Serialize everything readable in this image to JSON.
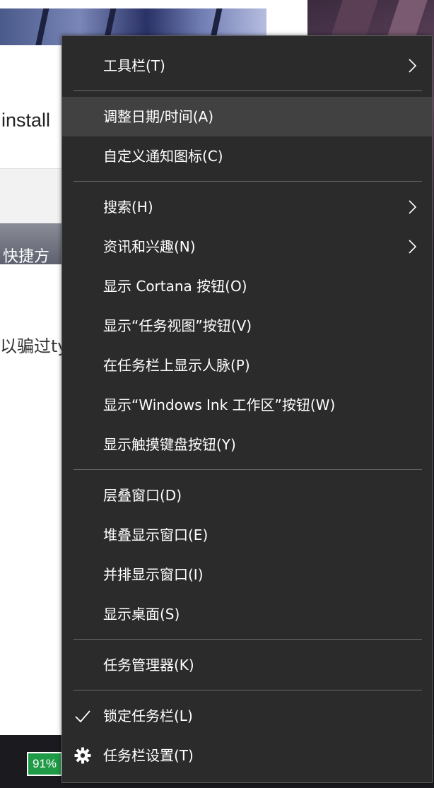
{
  "background": {
    "install_text": "install",
    "strip_text": "快捷方",
    "partial_text": "以骗过ty",
    "battery_level": "91%"
  },
  "context_menu": {
    "items": [
      {
        "label": "工具栏(T)",
        "submenu": true
      },
      {
        "label": "调整日期/时间(A)",
        "hover": true
      },
      {
        "label": "自定义通知图标(C)"
      },
      {
        "label": "搜索(H)",
        "submenu": true
      },
      {
        "label": "资讯和兴趣(N)",
        "submenu": true
      },
      {
        "label": "显示 Cortana 按钮(O)"
      },
      {
        "label": "显示“任务视图”按钮(V)"
      },
      {
        "label": "在任务栏上显示人脉(P)"
      },
      {
        "label": "显示“Windows Ink 工作区”按钮(W)"
      },
      {
        "label": "显示触摸键盘按钮(Y)"
      },
      {
        "label": "层叠窗口(D)"
      },
      {
        "label": "堆叠显示窗口(E)"
      },
      {
        "label": "并排显示窗口(I)"
      },
      {
        "label": "显示桌面(S)"
      },
      {
        "label": "任务管理器(K)"
      },
      {
        "label": "锁定任务栏(L)",
        "checked": true,
        "icon": "checkmark-icon"
      },
      {
        "label": "任务栏设置(T)",
        "icon": "gear-icon"
      }
    ]
  },
  "colors": {
    "menu_bg": "#2b2b2b",
    "menu_hover": "#414141",
    "menu_text": "#ffffff",
    "separator": "#6a6a6a",
    "battery_green": "#1f9a46"
  }
}
